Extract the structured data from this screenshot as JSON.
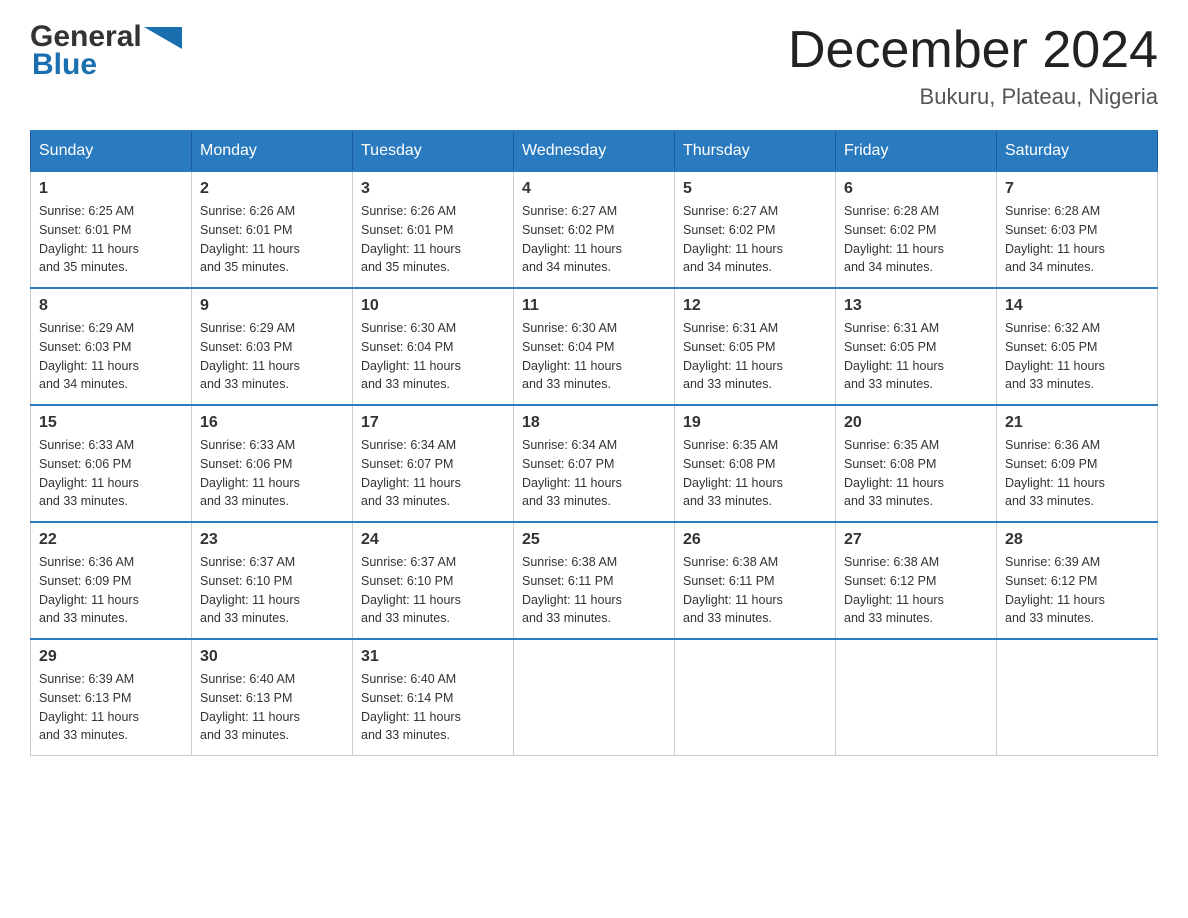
{
  "header": {
    "logo": {
      "text_general": "General",
      "text_blue": "Blue",
      "arrow_color": "#1a6faf"
    },
    "title": "December 2024",
    "location": "Bukuru, Plateau, Nigeria"
  },
  "calendar": {
    "days_of_week": [
      "Sunday",
      "Monday",
      "Tuesday",
      "Wednesday",
      "Thursday",
      "Friday",
      "Saturday"
    ],
    "weeks": [
      [
        {
          "day": "1",
          "sunrise": "6:25 AM",
          "sunset": "6:01 PM",
          "daylight": "11 hours and 35 minutes."
        },
        {
          "day": "2",
          "sunrise": "6:26 AM",
          "sunset": "6:01 PM",
          "daylight": "11 hours and 35 minutes."
        },
        {
          "day": "3",
          "sunrise": "6:26 AM",
          "sunset": "6:01 PM",
          "daylight": "11 hours and 35 minutes."
        },
        {
          "day": "4",
          "sunrise": "6:27 AM",
          "sunset": "6:02 PM",
          "daylight": "11 hours and 34 minutes."
        },
        {
          "day": "5",
          "sunrise": "6:27 AM",
          "sunset": "6:02 PM",
          "daylight": "11 hours and 34 minutes."
        },
        {
          "day": "6",
          "sunrise": "6:28 AM",
          "sunset": "6:02 PM",
          "daylight": "11 hours and 34 minutes."
        },
        {
          "day": "7",
          "sunrise": "6:28 AM",
          "sunset": "6:03 PM",
          "daylight": "11 hours and 34 minutes."
        }
      ],
      [
        {
          "day": "8",
          "sunrise": "6:29 AM",
          "sunset": "6:03 PM",
          "daylight": "11 hours and 34 minutes."
        },
        {
          "day": "9",
          "sunrise": "6:29 AM",
          "sunset": "6:03 PM",
          "daylight": "11 hours and 33 minutes."
        },
        {
          "day": "10",
          "sunrise": "6:30 AM",
          "sunset": "6:04 PM",
          "daylight": "11 hours and 33 minutes."
        },
        {
          "day": "11",
          "sunrise": "6:30 AM",
          "sunset": "6:04 PM",
          "daylight": "11 hours and 33 minutes."
        },
        {
          "day": "12",
          "sunrise": "6:31 AM",
          "sunset": "6:05 PM",
          "daylight": "11 hours and 33 minutes."
        },
        {
          "day": "13",
          "sunrise": "6:31 AM",
          "sunset": "6:05 PM",
          "daylight": "11 hours and 33 minutes."
        },
        {
          "day": "14",
          "sunrise": "6:32 AM",
          "sunset": "6:05 PM",
          "daylight": "11 hours and 33 minutes."
        }
      ],
      [
        {
          "day": "15",
          "sunrise": "6:33 AM",
          "sunset": "6:06 PM",
          "daylight": "11 hours and 33 minutes."
        },
        {
          "day": "16",
          "sunrise": "6:33 AM",
          "sunset": "6:06 PM",
          "daylight": "11 hours and 33 minutes."
        },
        {
          "day": "17",
          "sunrise": "6:34 AM",
          "sunset": "6:07 PM",
          "daylight": "11 hours and 33 minutes."
        },
        {
          "day": "18",
          "sunrise": "6:34 AM",
          "sunset": "6:07 PM",
          "daylight": "11 hours and 33 minutes."
        },
        {
          "day": "19",
          "sunrise": "6:35 AM",
          "sunset": "6:08 PM",
          "daylight": "11 hours and 33 minutes."
        },
        {
          "day": "20",
          "sunrise": "6:35 AM",
          "sunset": "6:08 PM",
          "daylight": "11 hours and 33 minutes."
        },
        {
          "day": "21",
          "sunrise": "6:36 AM",
          "sunset": "6:09 PM",
          "daylight": "11 hours and 33 minutes."
        }
      ],
      [
        {
          "day": "22",
          "sunrise": "6:36 AM",
          "sunset": "6:09 PM",
          "daylight": "11 hours and 33 minutes."
        },
        {
          "day": "23",
          "sunrise": "6:37 AM",
          "sunset": "6:10 PM",
          "daylight": "11 hours and 33 minutes."
        },
        {
          "day": "24",
          "sunrise": "6:37 AM",
          "sunset": "6:10 PM",
          "daylight": "11 hours and 33 minutes."
        },
        {
          "day": "25",
          "sunrise": "6:38 AM",
          "sunset": "6:11 PM",
          "daylight": "11 hours and 33 minutes."
        },
        {
          "day": "26",
          "sunrise": "6:38 AM",
          "sunset": "6:11 PM",
          "daylight": "11 hours and 33 minutes."
        },
        {
          "day": "27",
          "sunrise": "6:38 AM",
          "sunset": "6:12 PM",
          "daylight": "11 hours and 33 minutes."
        },
        {
          "day": "28",
          "sunrise": "6:39 AM",
          "sunset": "6:12 PM",
          "daylight": "11 hours and 33 minutes."
        }
      ],
      [
        {
          "day": "29",
          "sunrise": "6:39 AM",
          "sunset": "6:13 PM",
          "daylight": "11 hours and 33 minutes."
        },
        {
          "day": "30",
          "sunrise": "6:40 AM",
          "sunset": "6:13 PM",
          "daylight": "11 hours and 33 minutes."
        },
        {
          "day": "31",
          "sunrise": "6:40 AM",
          "sunset": "6:14 PM",
          "daylight": "11 hours and 33 minutes."
        },
        null,
        null,
        null,
        null
      ]
    ],
    "sunrise_label": "Sunrise:",
    "sunset_label": "Sunset:",
    "daylight_label": "Daylight:"
  }
}
